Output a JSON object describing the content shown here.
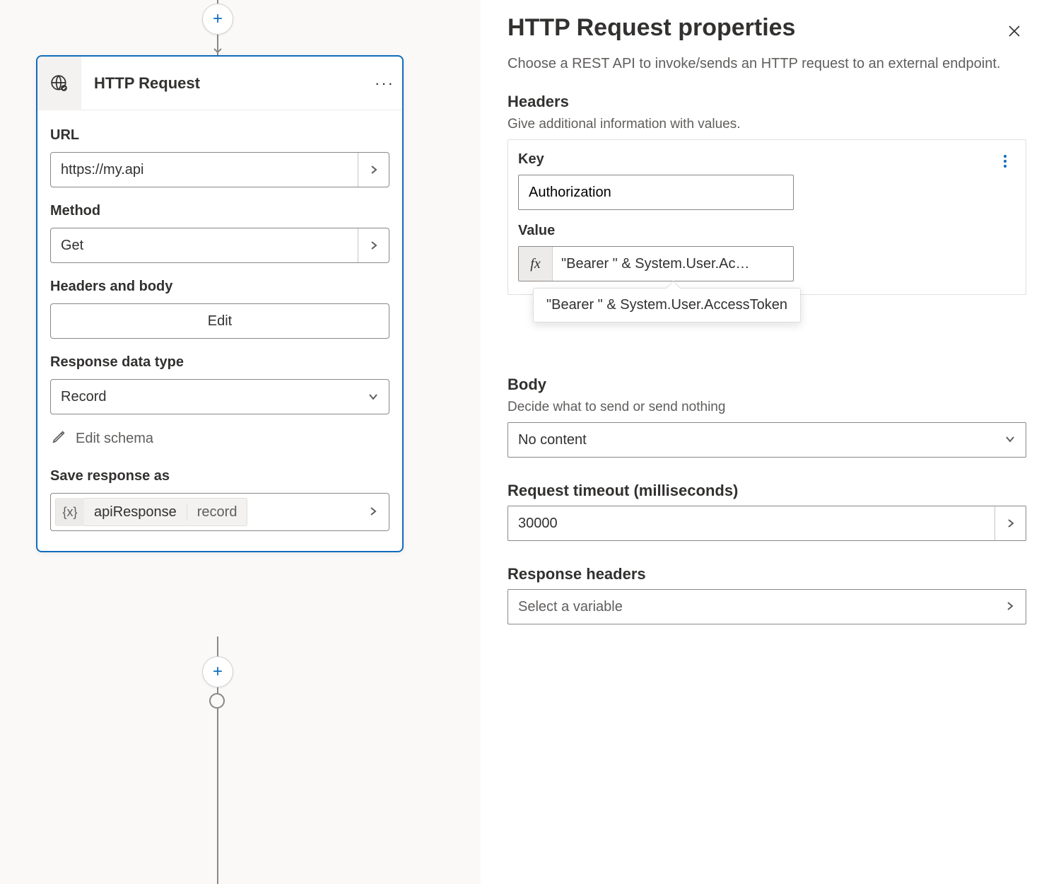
{
  "card": {
    "title": "HTTP Request",
    "fields": {
      "url_label": "URL",
      "url_value": "https://my.api",
      "method_label": "Method",
      "method_value": "Get",
      "headers_body_label": "Headers and body",
      "edit_button": "Edit",
      "response_type_label": "Response data type",
      "response_type_value": "Record",
      "edit_schema": "Edit schema",
      "save_as_label": "Save response as",
      "variable_name": "apiResponse",
      "variable_type": "record"
    }
  },
  "panel": {
    "title": "HTTP Request properties",
    "description": "Choose a REST API to invoke/sends an HTTP request to an external endpoint.",
    "headers": {
      "section_title": "Headers",
      "section_help": "Give additional information with values.",
      "key_label": "Key",
      "key_value": "Authorization",
      "value_label": "Value",
      "fx_label": "fx",
      "value_display": "\"Bearer \" & System.User.Ac…",
      "value_full": "\"Bearer \" & System.User.AccessToken"
    },
    "body": {
      "section_title": "Body",
      "section_help": "Decide what to send or send nothing",
      "value": "No content"
    },
    "timeout": {
      "label": "Request timeout (milliseconds)",
      "value": "30000"
    },
    "response_headers": {
      "label": "Response headers",
      "placeholder": "Select a variable"
    }
  }
}
